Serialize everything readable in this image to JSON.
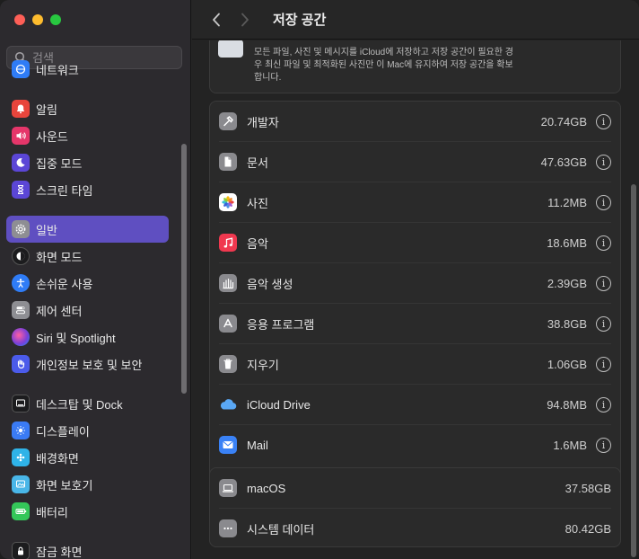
{
  "window": {
    "title": "저장 공간"
  },
  "search": {
    "placeholder": "검색"
  },
  "sidebar": {
    "items": [
      {
        "label": "네트워크",
        "icon": "network-icon",
        "color": "#2f7cf6"
      },
      {
        "label": "알림",
        "icon": "bell-icon",
        "color": "#e8453c"
      },
      {
        "label": "사운드",
        "icon": "speaker-icon",
        "color": "#e5366a"
      },
      {
        "label": "집중 모드",
        "icon": "moon-icon",
        "color": "#5b46d6"
      },
      {
        "label": "스크린 타임",
        "icon": "hourglass-icon",
        "color": "#5b46d6"
      },
      {
        "label": "일반",
        "icon": "gear-icon",
        "color": "#8e8e93",
        "active": true
      },
      {
        "label": "화면 모드",
        "icon": "appearance-icon",
        "color": "#1c1c1e"
      },
      {
        "label": "손쉬운 사용",
        "icon": "accessibility-icon",
        "color": "#2f7cf6"
      },
      {
        "label": "제어 센터",
        "icon": "control-center-icon",
        "color": "#8e8e93"
      },
      {
        "label": "Siri 및 Spotlight",
        "icon": "siri-icon",
        "color": "#7b3fd8"
      },
      {
        "label": "개인정보 보호 및 보안",
        "icon": "hand-icon",
        "color": "#4b5bea"
      },
      {
        "label": "데스크탑 및 Dock",
        "icon": "dock-icon",
        "color": "#1c1c1e"
      },
      {
        "label": "디스플레이",
        "icon": "display-icon",
        "color": "#3a7bf5"
      },
      {
        "label": "배경화면",
        "icon": "wallpaper-icon",
        "color": "#2fb3e8"
      },
      {
        "label": "화면 보호기",
        "icon": "screensaver-icon",
        "color": "#49b6e8"
      },
      {
        "label": "배터리",
        "icon": "battery-icon",
        "color": "#34c759"
      },
      {
        "label": "잠금 화면",
        "icon": "lock-icon",
        "color": "#1c1c1e"
      }
    ]
  },
  "optimize": {
    "description": "모든 파일, 사진 및 메시지를 iCloud에 저장하고 저장 공간이 필요한 경우 최신 파일 및 최적화된 사진만 이 Mac에 유지하여 저장 공간을 확보합니다."
  },
  "categories": [
    {
      "label": "개발자",
      "size": "20.74GB",
      "icon": "hammer-icon"
    },
    {
      "label": "문서",
      "size": "47.63GB",
      "icon": "document-icon"
    },
    {
      "label": "사진",
      "size": "11.2MB",
      "icon": "photos-icon"
    },
    {
      "label": "음악",
      "size": "18.6MB",
      "icon": "music-icon"
    },
    {
      "label": "음악 생성",
      "size": "2.39GB",
      "icon": "music-creation-icon"
    },
    {
      "label": "응용 프로그램",
      "size": "38.8GB",
      "icon": "app-store-icon"
    },
    {
      "label": "지우기",
      "size": "1.06GB",
      "icon": "trash-icon"
    },
    {
      "label": "iCloud Drive",
      "size": "94.8MB",
      "icon": "icloud-icon"
    },
    {
      "label": "Mail",
      "size": "1.6MB",
      "icon": "mail-icon"
    }
  ],
  "system": [
    {
      "label": "macOS",
      "size": "37.58GB",
      "icon": "laptop-icon"
    },
    {
      "label": "시스템 데이터",
      "size": "80.42GB",
      "icon": "ellipsis-icon"
    }
  ],
  "info_glyph": "i",
  "colors": {
    "accent": "#5f4fc1",
    "close": "#fe5f57",
    "minimize": "#febc2e",
    "maximize": "#28c840"
  }
}
